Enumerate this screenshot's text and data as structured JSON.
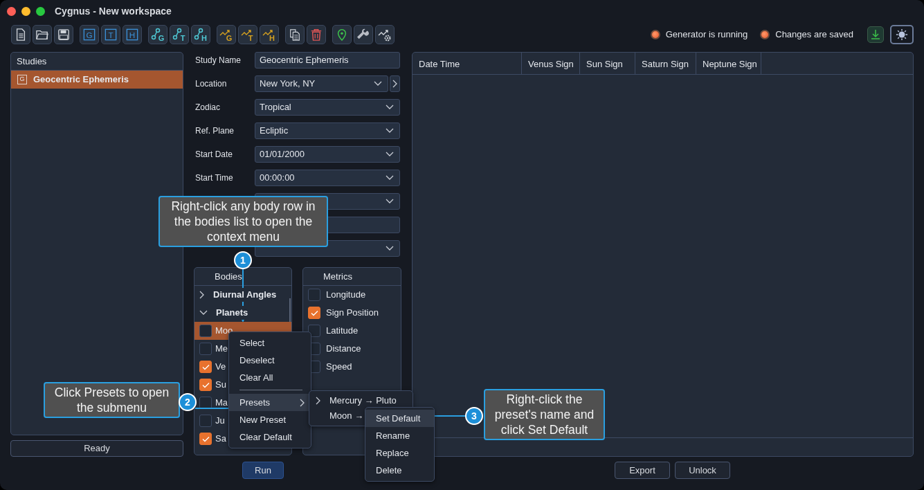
{
  "window": {
    "title": "Cygnus - New workspace"
  },
  "toolbar": {
    "groups": [
      [
        {
          "kind": "new"
        },
        {
          "kind": "open"
        },
        {
          "kind": "save"
        }
      ],
      [
        {
          "kind": "boxed",
          "letter": "G"
        },
        {
          "kind": "boxed",
          "letter": "T"
        },
        {
          "kind": "boxed",
          "letter": "H"
        }
      ],
      [
        {
          "kind": "nodes",
          "letter": "G"
        },
        {
          "kind": "nodes",
          "letter": "T"
        },
        {
          "kind": "nodes",
          "letter": "H"
        }
      ],
      [
        {
          "kind": "trend",
          "letter": "G"
        },
        {
          "kind": "trend",
          "letter": "T"
        },
        {
          "kind": "trend",
          "letter": "H"
        }
      ],
      [
        {
          "kind": "copy"
        },
        {
          "kind": "delete"
        }
      ],
      [
        {
          "kind": "pin"
        },
        {
          "kind": "wrench"
        },
        {
          "kind": "trend-gear"
        }
      ]
    ],
    "indicators": [
      {
        "label": "Generator is running",
        "on": true
      },
      {
        "label": "Changes are saved",
        "on": true
      }
    ],
    "right_buttons": [
      {
        "kind": "download"
      },
      {
        "kind": "theme"
      }
    ]
  },
  "studies": {
    "title": "Studies",
    "items": [
      {
        "badge": "G",
        "name": "Geocentric Ephemeris",
        "selected": true
      }
    ]
  },
  "status_bar": "Ready",
  "form": [
    {
      "label": "Study Name",
      "value": "Geocentric Ephemeris",
      "kind": "text"
    },
    {
      "label": "Location",
      "value": "New York, NY",
      "kind": "select-nav"
    },
    {
      "label": "Zodiac",
      "value": "Tropical",
      "kind": "select"
    },
    {
      "label": "Ref. Plane",
      "value": "Ecliptic",
      "kind": "select"
    },
    {
      "label": "Start Date",
      "value": "01/01/2000",
      "kind": "select"
    },
    {
      "label": "Start Time",
      "value": "00:00:00",
      "kind": "select"
    },
    {
      "kind": "select"
    },
    {
      "kind": "text"
    },
    {
      "kind": "select"
    }
  ],
  "bodies": {
    "title": "Bodies",
    "groups": [
      {
        "name": "Diurnal Angles",
        "expanded": false
      },
      {
        "name": "Planets",
        "expanded": true,
        "children": [
          {
            "name": "Moo",
            "checked": false,
            "selected": true
          },
          {
            "name": "Me",
            "checked": false,
            "selected": false
          },
          {
            "name": "Ve",
            "checked": true,
            "selected": false
          },
          {
            "name": "Su",
            "checked": true,
            "selected": false
          },
          {
            "name": "Ma",
            "checked": false,
            "selected": false
          },
          {
            "name": "Ju",
            "checked": false,
            "selected": false
          },
          {
            "name": "Sa",
            "checked": true,
            "selected": false
          }
        ]
      }
    ]
  },
  "metrics": {
    "title": "Metrics",
    "items": [
      {
        "name": "Longitude",
        "checked": false
      },
      {
        "name": "Sign Position",
        "checked": true
      },
      {
        "name": "Latitude",
        "checked": false
      },
      {
        "name": "Distance",
        "checked": false
      },
      {
        "name": "Speed",
        "checked": false
      }
    ]
  },
  "table": {
    "columns": [
      "Date Time",
      "Venus Sign",
      "Sun Sign",
      "Saturn Sign",
      "Neptune Sign"
    ]
  },
  "buttons": [
    {
      "label": "Run",
      "kind": "primary"
    },
    {
      "label": "Export",
      "kind": "secondary"
    },
    {
      "label": "Unlock",
      "kind": "secondary"
    }
  ],
  "context_menu": [
    {
      "kind": "item",
      "label": "Select",
      "selected": false
    },
    {
      "kind": "item",
      "label": "Deselect",
      "selected": false
    },
    {
      "kind": "item",
      "label": "Clear All",
      "selected": false
    },
    {
      "kind": "separator"
    },
    {
      "kind": "submenu",
      "label": "Presets",
      "selected": true
    },
    {
      "kind": "item",
      "label": "New Preset",
      "selected": false
    },
    {
      "kind": "item",
      "label": "Clear Default",
      "selected": false
    }
  ],
  "presets_menu": [
    {
      "kind": "group",
      "label": "Mercury → Pluto"
    },
    {
      "kind": "preset",
      "label": "Moon →"
    }
  ],
  "preset_actions": [
    {
      "label": "Set Default",
      "selected": true
    },
    {
      "label": "Rename",
      "selected": false
    },
    {
      "label": "Replace",
      "selected": false
    },
    {
      "label": "Delete",
      "selected": false
    }
  ],
  "callouts": [
    {
      "number": "1",
      "text": "Right-click any body row in the bodies list to open the context menu"
    },
    {
      "number": "2",
      "text": "Click Presets to open the submenu"
    },
    {
      "number": "3",
      "text": "Right-click the preset's name and click Set Default"
    }
  ]
}
